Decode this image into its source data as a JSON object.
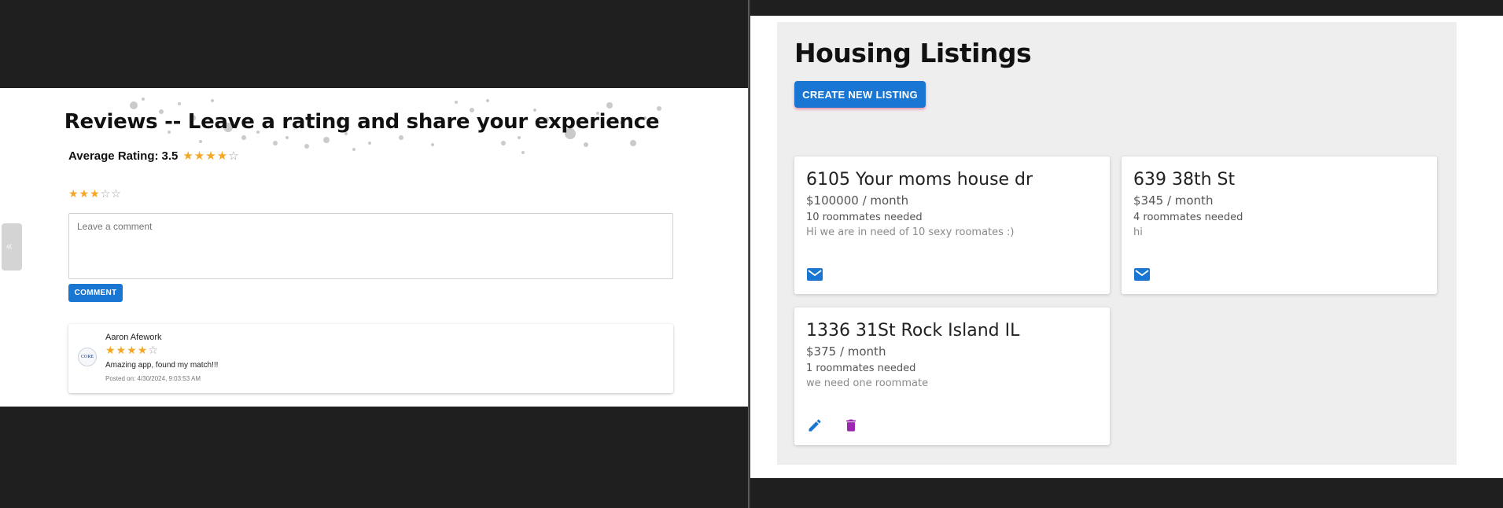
{
  "reviews_page": {
    "title": "Reviews -- Leave a rating and share your experience",
    "average": {
      "label": "Average Rating:",
      "value": "3.5",
      "stars_filled": 4,
      "stars_total": 5
    },
    "rating_input": {
      "stars_filled": 3,
      "stars_total": 5
    },
    "comment": {
      "placeholder": "Leave a comment",
      "value": ""
    },
    "comment_button_label": "COMMENT",
    "back_tab_glyph": "«",
    "reviews": [
      {
        "author": "Aaron Afework",
        "avatar_text": "CORE",
        "rating": 4,
        "stars_total": 5,
        "text": "Amazing app, found my match!!!",
        "posted": "Posted on: 4/30/2024, 9:03:53 AM"
      }
    ]
  },
  "listings_page": {
    "title": "Housing Listings",
    "create_button_label": "CREATE NEW LISTING",
    "listings": [
      {
        "address": "6105 Your moms house dr",
        "price": "$100000 / month",
        "roommates": "10 roommates needed",
        "description": "Hi we are in need of 10 sexy roomates :)",
        "actions": [
          "mail-icon"
        ]
      },
      {
        "address": "639 38th St",
        "price": "$345 / month",
        "roommates": "4 roommates needed",
        "description": "hi",
        "actions": [
          "mail-icon"
        ]
      },
      {
        "address": "1336 31St Rock Island IL",
        "price": "$375 / month",
        "roommates": "1 roommates needed",
        "description": "we need one roommate",
        "actions": [
          "edit-icon",
          "delete-icon"
        ]
      }
    ]
  },
  "colors": {
    "primary": "#1976d2",
    "star": "#f5a623",
    "delete": "#9c27b0",
    "panel": "#eeeeee",
    "backdrop": "#1f1f1f"
  }
}
